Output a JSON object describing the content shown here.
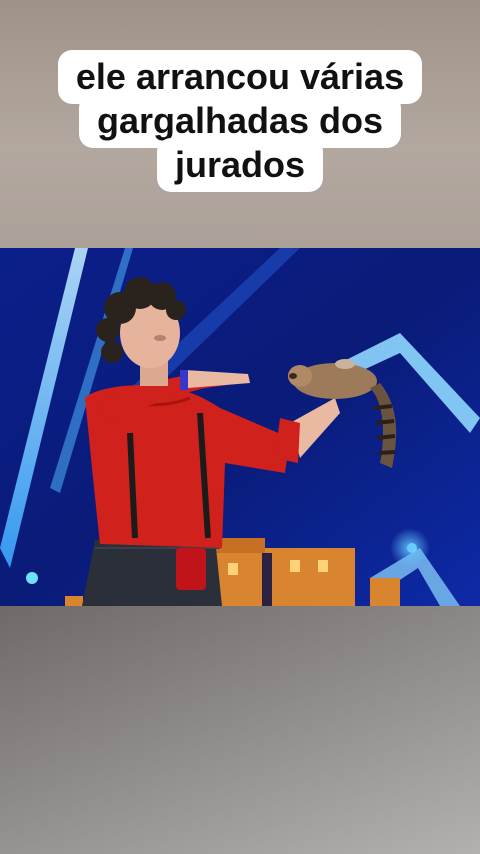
{
  "caption": {
    "lines": [
      "ele arrancou várias",
      "gargalhadas dos",
      "jurados"
    ]
  },
  "scene": {
    "subject": "performer-with-raccoon-puppet",
    "colors": {
      "stage_blue": "#0d2aa6",
      "shirt_red": "#d0211c",
      "puppet_fur": "#9c7a5a"
    }
  }
}
